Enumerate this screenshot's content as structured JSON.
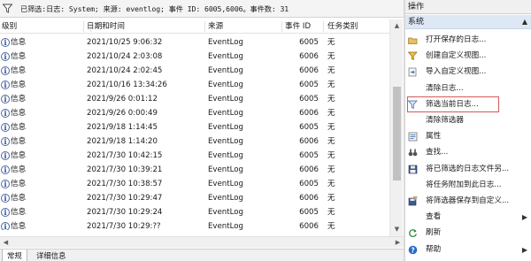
{
  "filter_bar": {
    "icon": "funnel-icon",
    "text": "已筛选:日志: System; 来源: eventlog; 事件 ID: 6005,6006。事件数: 31"
  },
  "table": {
    "columns": [
      "级别",
      "日期和时间",
      "来源",
      "事件 ID",
      "任务类别"
    ],
    "rows": [
      {
        "level": "信息",
        "date": "2021/10/25 9:06:32",
        "source": "EventLog",
        "id": "6005",
        "task": "无"
      },
      {
        "level": "信息",
        "date": "2021/10/24 2:03:08",
        "source": "EventLog",
        "id": "6006",
        "task": "无"
      },
      {
        "level": "信息",
        "date": "2021/10/24 2:02:45",
        "source": "EventLog",
        "id": "6006",
        "task": "无"
      },
      {
        "level": "信息",
        "date": "2021/10/16 13:34:26",
        "source": "EventLog",
        "id": "6005",
        "task": "无"
      },
      {
        "level": "信息",
        "date": "2021/9/26 0:01:12",
        "source": "EventLog",
        "id": "6005",
        "task": "无"
      },
      {
        "level": "信息",
        "date": "2021/9/26 0:00:49",
        "source": "EventLog",
        "id": "6006",
        "task": "无"
      },
      {
        "level": "信息",
        "date": "2021/9/18 1:14:45",
        "source": "EventLog",
        "id": "6005",
        "task": "无"
      },
      {
        "level": "信息",
        "date": "2021/9/18 1:14:20",
        "source": "EventLog",
        "id": "6006",
        "task": "无"
      },
      {
        "level": "信息",
        "date": "2021/7/30 10:42:15",
        "source": "EventLog",
        "id": "6005",
        "task": "无"
      },
      {
        "level": "信息",
        "date": "2021/7/30 10:39:21",
        "source": "EventLog",
        "id": "6006",
        "task": "无"
      },
      {
        "level": "信息",
        "date": "2021/7/30 10:38:57",
        "source": "EventLog",
        "id": "6005",
        "task": "无"
      },
      {
        "level": "信息",
        "date": "2021/7/30 10:29:47",
        "source": "EventLog",
        "id": "6006",
        "task": "无"
      },
      {
        "level": "信息",
        "date": "2021/7/30 10:29:24",
        "source": "EventLog",
        "id": "6005",
        "task": "无"
      },
      {
        "level": "信息",
        "date": "2021/7/30 10:29:??",
        "source": "EventLog",
        "id": "6006",
        "task": "无"
      }
    ]
  },
  "bottom_tabs": [
    "常规",
    "详细信息"
  ],
  "actions_pane": {
    "header": "操作",
    "section": "系统",
    "items": [
      {
        "label": "打开保存的日志...",
        "icon": "folder-open-icon"
      },
      {
        "label": "创建自定义视图...",
        "icon": "filter-create-icon"
      },
      {
        "label": "导入自定义视图...",
        "icon": "import-icon"
      },
      {
        "label": "清除日志...",
        "icon": ""
      },
      {
        "label": "筛选当前日志...",
        "icon": "filter-icon"
      },
      {
        "label": "清除筛选器",
        "icon": ""
      },
      {
        "label": "属性",
        "icon": "properties-icon"
      },
      {
        "label": "查找...",
        "icon": "binoculars-icon"
      },
      {
        "label": "将已筛选的日志文件另...",
        "icon": "save-icon"
      },
      {
        "label": "将任务附加到此日志...",
        "icon": ""
      },
      {
        "label": "将筛选器保存到自定义...",
        "icon": "save-filter-icon"
      },
      {
        "label": "查看",
        "icon": "",
        "submenu": "▶"
      },
      {
        "label": "刷新",
        "icon": "refresh-icon"
      },
      {
        "label": "帮助",
        "icon": "help-icon",
        "submenu": "▶"
      }
    ]
  },
  "colors": {
    "section_bg": "#dde8f4",
    "highlight_border": "#d15a5a",
    "info_icon": "#4a6aa8"
  }
}
